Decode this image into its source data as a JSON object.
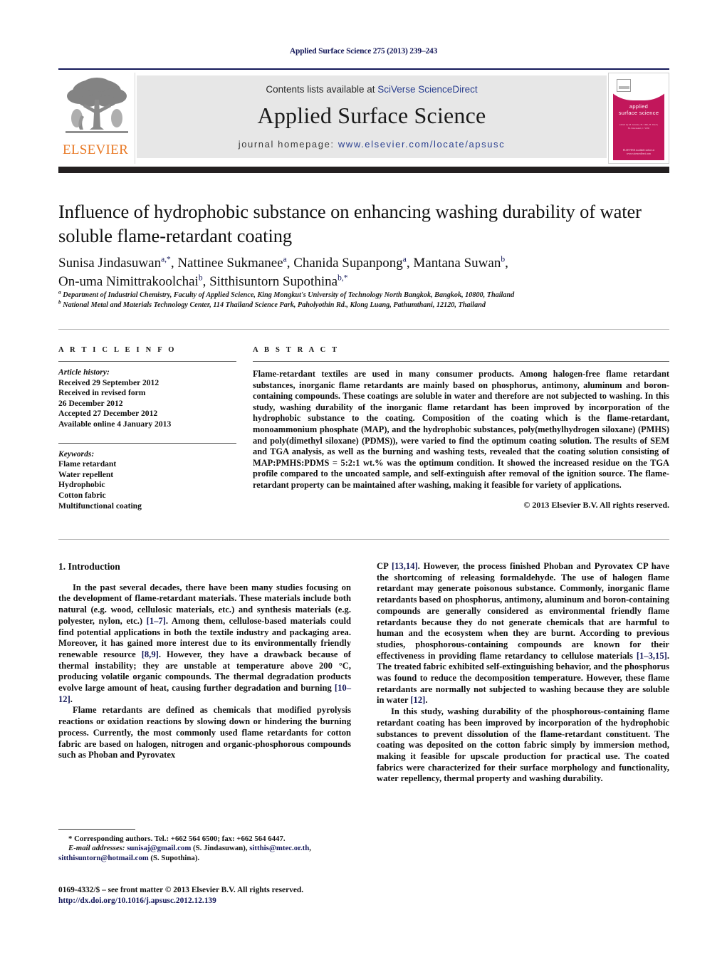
{
  "running_head": "Applied Surface Science 275 (2013) 239–243",
  "masthead": {
    "contents_prefix": "Contents lists available at ",
    "sciencedirect": "SciVerse ScienceDirect",
    "journal_name": "Applied Surface Science",
    "homepage_prefix": "journal homepage: ",
    "homepage_url": "www.elsevier.com/locate/apsusc",
    "publisher_logo_text": "ELSEVIER",
    "cover": {
      "title_line1": "applied",
      "title_line2": "surface science",
      "subtitle": "edited by M. Grunze, H. Lüth, H. Ibach, M. Kawasaki, C. Wöll",
      "footer": "ELSEVIER\navailable online at www.sciencedirect.com"
    }
  },
  "article": {
    "title": "Influence of hydrophobic substance on enhancing washing durability of water soluble flame-retardant coating",
    "authors_line1": "Sunisa Jindasuwan",
    "authors_line1_sup": "a,*",
    "authors": [
      {
        "name": "Sunisa Jindasuwan",
        "sup": "a,*"
      },
      {
        "name": "Nattinee Sukmanee",
        "sup": "a"
      },
      {
        "name": "Chanida Supanpong",
        "sup": "a"
      },
      {
        "name": "Mantana Suwan",
        "sup": "b"
      },
      {
        "name": "On-uma Nimittrakoolchai",
        "sup": "b"
      },
      {
        "name": "Sitthisuntorn Supothina",
        "sup": "b,*"
      }
    ],
    "affiliations": [
      {
        "marker": "a",
        "text": "Department of Industrial Chemistry, Faculty of Applied Science, King Mongkut's University of Technology North Bangkok, Bangkok, 10800, Thailand"
      },
      {
        "marker": "b",
        "text": "National Metal and Materials Technology Center, 114 Thailand Science Park, Paholyothin Rd., Klong Luang, Pathumthani, 12120, Thailand"
      }
    ]
  },
  "article_info": {
    "heading": "A R T I C L E   I N F O",
    "history_label": "Article history:",
    "history": [
      "Received 29 September 2012",
      "Received in revised form",
      "26 December 2012",
      "Accepted 27 December 2012",
      "Available online 4 January 2013"
    ],
    "keywords_label": "Keywords:",
    "keywords": [
      "Flame retardant",
      "Water repellent",
      "Hydrophobic",
      "Cotton fabric",
      "Multifunctional coating"
    ]
  },
  "abstract": {
    "heading": "A B S T R A C T",
    "text": "Flame-retardant textiles are used in many consumer products. Among halogen-free flame retardant substances, inorganic flame retardants are mainly based on phosphorus, antimony, aluminum and boron-containing compounds. These coatings are soluble in water and therefore are not subjected to washing. In this study, washing durability of the inorganic flame retardant has been improved by incorporation of the hydrophobic substance to the coating. Composition of the coating which is the flame-retardant, monoammonium phosphate (MAP), and the hydrophobic substances, poly(methylhydrogen siloxane) (PMHS) and poly(dimethyl siloxane) (PDMS)), were varied to find the optimum coating solution. The results of SEM and TGA analysis, as well as the burning and washing tests, revealed that the coating solution consisting of MAP:PMHS:PDMS = 5:2:1 wt.% was the optimum condition. It showed the increased residue on the TGA profile compared to the uncoated sample, and self-extinguish after removal of the ignition source. The flame-retardant property can be maintained after washing, making it feasible for variety of applications.",
    "copyright": "© 2013 Elsevier B.V. All rights reserved."
  },
  "body": {
    "section_title": "1.  Introduction",
    "left_p1_a": "In the past several decades, there have been many studies focusing on the development of flame-retardant materials. These materials include both natural (e.g. wood, cellulosic materials, etc.) and synthesis materials (e.g. polyester, nylon, etc.) ",
    "left_p1_ref1": "[1–7]",
    "left_p1_b": ". Among them, cellulose-based materials could find potential applications in both the textile industry and packaging area. Moreover, it has gained more interest due to its environmentally friendly renewable resource ",
    "left_p1_ref2": "[8,9]",
    "left_p1_c": ". However, they have a drawback because of thermal instability; they are unstable at temperature above 200 °C, producing volatile organic compounds. The thermal degradation products evolve large amount of heat, causing further degradation and burning ",
    "left_p1_ref3": "[10–12]",
    "left_p1_d": ".",
    "left_p2": "Flame retardants are defined as chemicals that modified pyrolysis reactions or oxidation reactions by slowing down or hindering the burning process. Currently, the most commonly used flame retardants for cotton fabric are based on halogen, nitrogen and organic-phosphorous compounds such as Phoban and Pyrovatex",
    "right_p1_a": "CP ",
    "right_p1_ref1": "[13,14]",
    "right_p1_b": ". However, the process finished Phoban and Pyrovatex CP have the shortcoming of releasing formaldehyde. The use of halogen flame retardant may generate poisonous substance. Commonly, inorganic flame retardants based on phosphorus, antimony, aluminum and boron-containing compounds are generally considered as environmental friendly flame retardants because they do not generate chemicals that are harmful to human and the ecosystem when they are burnt. According to previous studies, phosphorous-containing compounds are known for their effectiveness in providing flame retardancy to cellulose materials ",
    "right_p1_ref2": "[1–3,15]",
    "right_p1_c": ". The treated fabric exhibited self-extinguishing behavior, and the phosphorus was found to reduce the decomposition temperature. However, these flame retardants are normally not subjected to washing because they are soluble in water ",
    "right_p1_ref3": "[12]",
    "right_p1_d": ".",
    "right_p2": "In this study, washing durability of the phosphorous-containing flame retardant coating has been improved by incorporation of the hydrophobic substances to prevent dissolution of the flame-retardant constituent. The coating was deposited on the cotton fabric simply by immersion method, making it feasible for upscale production for practical use. The coated fabrics were characterized for their surface morphology and functionality, water repellency, thermal property and washing durability."
  },
  "footnotes": {
    "corresponding": "* Corresponding authors. Tel.: +662 564 6500; fax: +662 564 6447.",
    "email_label": "E-mail addresses:",
    "email_1": "sunisaj@gmail.com",
    "email_1_who": " (S. Jindasuwan), ",
    "email_2": "sitthis@mtec.or.th",
    "email_2_sep": ", ",
    "email_3": "sitthisuntorn@hotmail.com",
    "email_3_who": " (S. Supothina)."
  },
  "imprint": {
    "issn_line": "0169-4332/$ – see front matter © 2013 Elsevier B.V. All rights reserved.",
    "doi": "http://dx.doi.org/10.1016/j.apsusc.2012.12.139"
  },
  "colors": {
    "link": "#15195a",
    "elsevier_orange": "#e87722",
    "cover_magenta": "#c2175b",
    "masthead_grey": "#e7e7e7",
    "dark_bar": "#231f20"
  }
}
